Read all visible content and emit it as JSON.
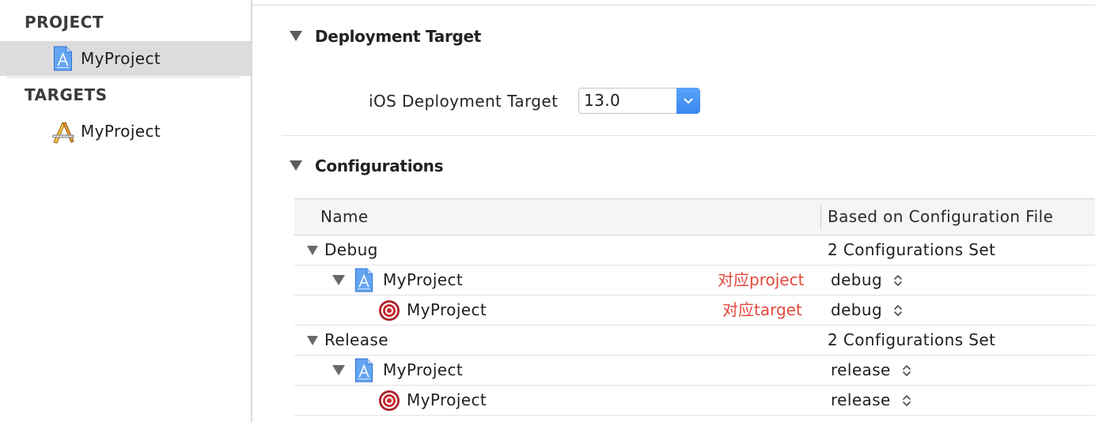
{
  "sidebar": {
    "project_header": "PROJECT",
    "projects": [
      {
        "label": "MyProject",
        "icon": "project-icon",
        "selected": true
      }
    ],
    "targets_header": "TARGETS",
    "targets": [
      {
        "label": "MyProject",
        "icon": "app-target-icon",
        "selected": false
      }
    ]
  },
  "deployment": {
    "title": "Deployment Target",
    "expanded": true,
    "ios_label": "iOS Deployment Target",
    "ios_value": "13.0"
  },
  "configurations": {
    "title": "Configurations",
    "expanded": true,
    "columns": [
      "Name",
      "Based on Configuration File"
    ],
    "groups": [
      {
        "name": "Debug",
        "summary": "2 Configurations Set",
        "rows": [
          {
            "name": "MyProject",
            "icon": "project-icon",
            "annotation": "对应project",
            "file": "debug"
          },
          {
            "name": "MyProject",
            "icon": "target-icon",
            "annotation": "对应target",
            "file": "debug"
          }
        ]
      },
      {
        "name": "Release",
        "summary": "2 Configurations Set",
        "rows": [
          {
            "name": "MyProject",
            "icon": "project-icon",
            "file": "release"
          },
          {
            "name": "MyProject",
            "icon": "target-icon",
            "file": "release"
          }
        ]
      }
    ]
  },
  "colors": {
    "accent": "#3a86f2",
    "annotation": "#e2493d",
    "selection": "#dcdcdc"
  }
}
